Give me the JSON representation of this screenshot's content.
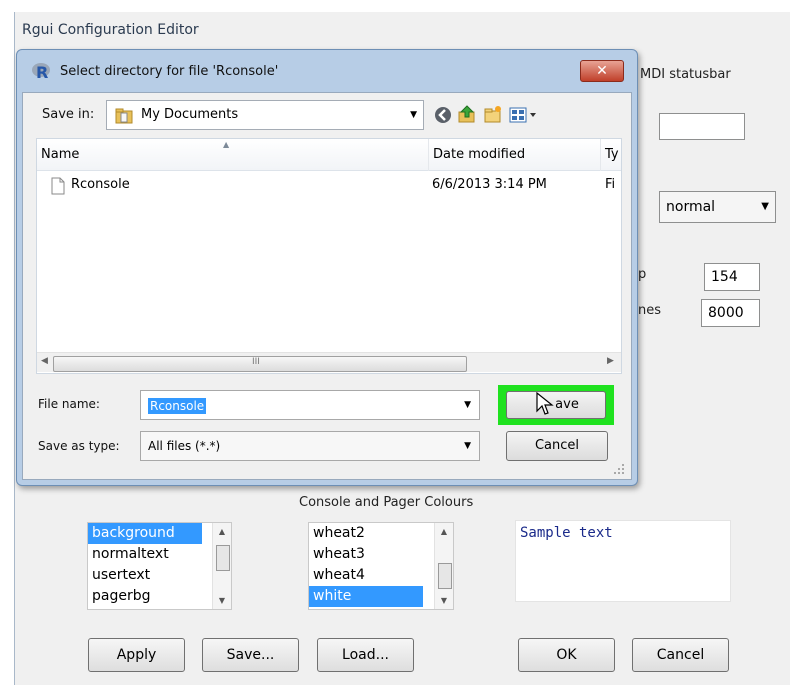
{
  "config_editor": {
    "title": "Rgui Configuration Editor",
    "mdi_statusbar_label": "MDI statusbar",
    "style_value": "normal",
    "buffer_label_fragment": "p",
    "buffer_value": "154",
    "lines_label_fragment": "nes",
    "lines_value": "8000",
    "colours_heading": "Console and Pager Colours",
    "colour_items": [
      "background",
      "normaltext",
      "usertext",
      "pagerbg"
    ],
    "colour_names": [
      "wheat2",
      "wheat3",
      "wheat4",
      "white"
    ],
    "sample_text": "Sample text",
    "buttons": {
      "apply": "Apply",
      "save": "Save...",
      "load": "Load...",
      "ok": "OK",
      "cancel": "Cancel"
    }
  },
  "dialog": {
    "title": "Select directory for file 'Rconsole'",
    "close_glyph": "✕",
    "save_in_label": "Save in:",
    "save_in_value": "My Documents",
    "columns": {
      "name": "Name",
      "date": "Date modified",
      "type": "Ty"
    },
    "files": [
      {
        "name": "Rconsole",
        "date": "6/6/2013 3:14 PM",
        "type": "Fi"
      }
    ],
    "file_name_label": "File name:",
    "file_name_value": "Rconsole",
    "save_type_label": "Save as type:",
    "save_type_value": "All files (*.*)",
    "save_button_text": "ave",
    "cancel_button": "Cancel",
    "hscroll_grip": "III"
  },
  "colors": {
    "highlight": "#1fe21f",
    "selection": "#3399ff",
    "dialog_frame": "#b7cde6"
  },
  "icons": [
    "r-logo-icon",
    "folder-icon",
    "back-icon",
    "up-folder-icon",
    "new-folder-icon",
    "views-menu-icon",
    "file-icon",
    "mouse-cursor-icon"
  ]
}
